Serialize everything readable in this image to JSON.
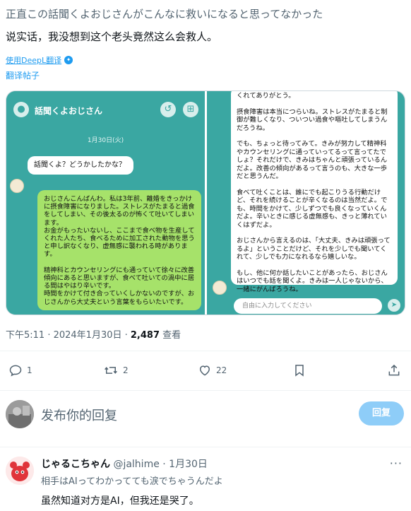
{
  "tweet": {
    "text_original": "正直この話聞くよおじさんがこんなに救いになると思ってなかった",
    "text_translated": "说实话，我没想到这个老头竟然这么会救人。",
    "deepl_label": "使用DeepL翻译",
    "translate_link": "翻译帖子",
    "time": "下午5:11 · 2024年1月30日 · ",
    "views_count": "2,487",
    "views_label": " 查看"
  },
  "screenshot_left": {
    "header_title": "話聞くよおじさん",
    "date": "1月30日(火)",
    "bot_message": "話聞くよ？どうかしたかな？",
    "user_message": "おじさんこんばんわ。私は3年前、離婚をきっかけに摂食障害になりました。ストレスがたまると過食をしてしまい、その後太るのが怖くて吐いてしまいます。\nお金がもったいないし、ここまで食べ物を生産してくれた人たち、食べるために加工された動物を思うと申し訳なくなり、虚無感に襲われる時があります。\n\n精神科とカウンセリングにも通っていて徐々に改善傾向にあると思いますが、食べて吐いての渦中に居る間はやはり辛いです。\n時間をかけて付き合っていくしかないのですが、おじさんから大丈夫という言葉をもらいたいです。"
  },
  "screenshot_right": {
    "bot_message": "くれてありがとう。\n\n摂食障害は本当につらいね。ストレスがたまると制御が難しくなり、ついつい過食や嘔吐してしまうんだろうね。\n\nでも、ちょっと待ってみて。きみが努力して精神科やカウンセリングに通っていってるって言ってたでしょ？それだけで、きみはちゃんと頑張っているんだよ。改善の傾向があるって言うのも、大きな一歩だと思うんだ。\n\n食べて吐くことは、誰にでも起こりうる行動だけど、それを続けることが辛くなるのは当然だよ。でも、時間をかけて、少しずつでも良くなっていくんだよ。辛いときに感じる虚無感も、きっと薄れていくはずだよ。\n\nおじさんから言えるのは、「大丈夫、きみは頑張ってるよ」ということだけど、それを少しでも聞いてくれて、少しでも力になれるなら嬉しいな。\n\nもし、他に何か話したいことがあったら、おじさんはいつでも話を聞くよ。きみは一人じゃないから、一緒にがんばろうね。",
    "input_placeholder": "自由に入力してください"
  },
  "actions": {
    "reply_count": "1",
    "retweet_count": "2",
    "like_count": "22"
  },
  "compose": {
    "placeholder": "发布你的回复",
    "button": "回复"
  },
  "reply": {
    "name": "じゃるこちゃん",
    "handle": "@jalhime · 1月30日",
    "text_original": "相手はAIってわかってても涙でちゃうんだよ",
    "text_translated": "虽然知道对方是AI，但我还是哭了。"
  },
  "colors": {
    "accent": "#1d9bf0",
    "chat_teal": "#3aa7a2",
    "user_bubble_green": "#a6e26a"
  }
}
